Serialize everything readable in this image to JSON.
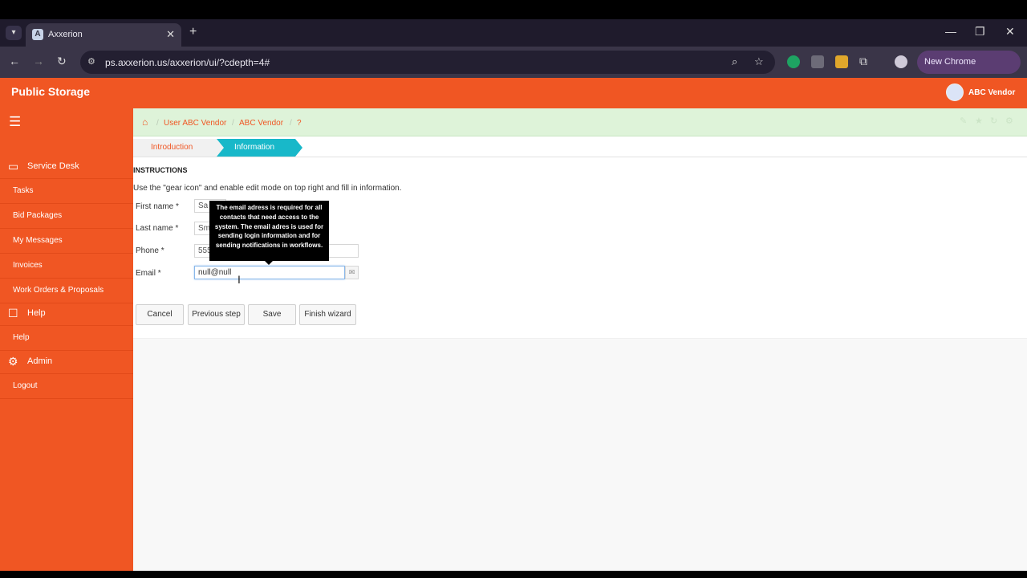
{
  "browser": {
    "tab_title": "Axxerion",
    "tab_favicon": "A",
    "url": "ps.axxerion.us/axxerion/ui/?cdepth=4#",
    "new_chrome_label": "New Chrome available",
    "icons": [
      "back-icon",
      "forward-icon",
      "reload-icon",
      "zoom-icon",
      "star-icon",
      "extensions-icon"
    ]
  },
  "app": {
    "brand": "Public Storage",
    "user_name": "ABC Vendor",
    "accent_color": "#f05623"
  },
  "sidebar": {
    "sections": [
      {
        "label": "Service Desk",
        "icon": "monitor-icon"
      },
      {
        "label": "Help",
        "icon": "square-icon"
      },
      {
        "label": "Admin",
        "icon": "gear-icon"
      }
    ],
    "items": [
      "Tasks",
      "Bid Packages",
      "My Messages",
      "Invoices",
      "Work Orders & Proposals",
      "Help",
      "Logout"
    ]
  },
  "breadcrumb": [
    "User ABC Vendor",
    "ABC Vendor",
    "?"
  ],
  "steps": {
    "intro": "Introduction",
    "info": "Information"
  },
  "instructions": {
    "title": "INSTRUCTIONS",
    "text": "Use the \"gear icon\" and enable edit mode on top right and fill in information."
  },
  "form": {
    "first_name_label": "First name *",
    "first_name_value": "Sa",
    "last_name_label": "Last name *",
    "last_name_value": "Sm",
    "phone_label": "Phone *",
    "phone_value": "555",
    "email_label": "Email *",
    "email_value": "null@null"
  },
  "tooltip": "The email adress is required for all contacts that need access to the system. The email adres is used for sending login information and for sending notifications in workflows.",
  "buttons": {
    "cancel": "Cancel",
    "previous": "Previous step",
    "save": "Save",
    "finish": "Finish wizard"
  }
}
